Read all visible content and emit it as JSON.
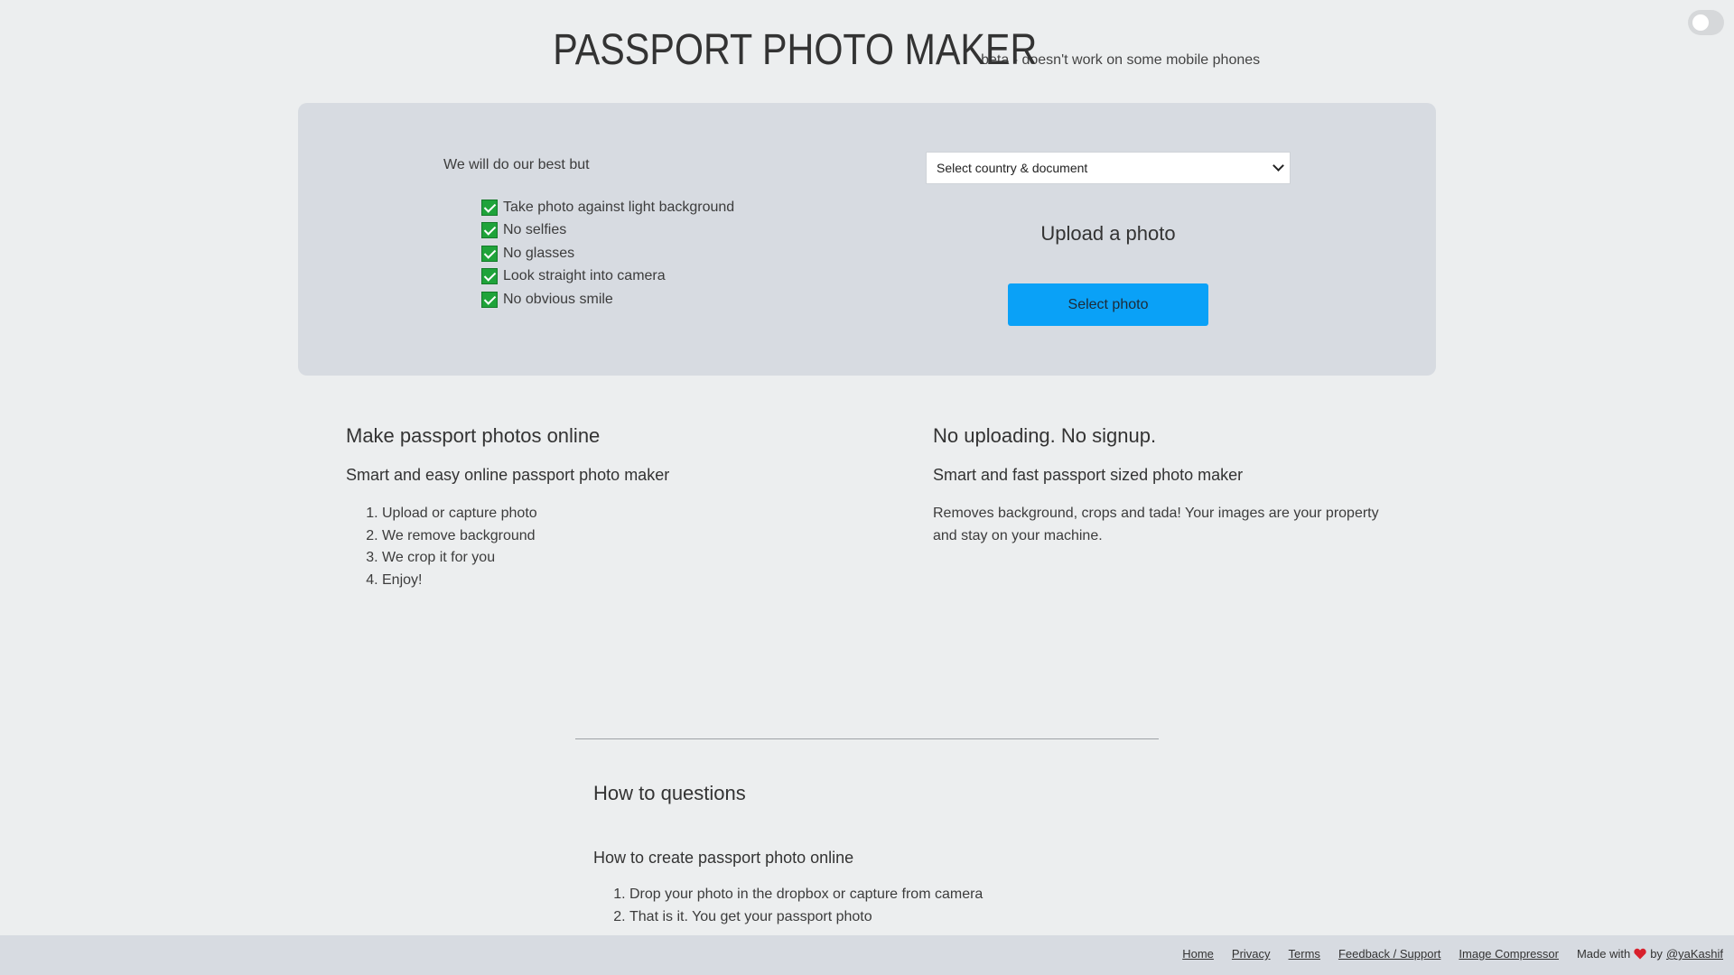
{
  "header": {
    "title": "PASSPORT PHOTO MAKER",
    "subtitle": "beta - doesn't work on some mobile phones"
  },
  "theme_toggle": {
    "icon": "toggle-switch-icon",
    "state": "off"
  },
  "hero": {
    "intro": "We will do our best but",
    "checklist": [
      "Take photo against light background",
      "No selfies",
      "No glasses",
      "Look straight into camera",
      "No obvious smile"
    ],
    "country_select": {
      "selected": "Select country & document"
    },
    "upload_heading": "Upload a photo",
    "select_button": "Select photo",
    "accent_color": "#0aa1f7",
    "check_color": "#1fa33a"
  },
  "left_col": {
    "heading": "Make passport photos online",
    "subheading": "Smart and easy online passport photo maker",
    "steps": [
      "Upload or capture photo",
      "We remove background",
      "We crop it for you",
      "Enjoy!"
    ]
  },
  "right_col": {
    "heading": "No uploading. No signup.",
    "subheading": "Smart and fast passport sized photo maker",
    "text": "Removes background, crops and tada! Your images are your property and stay on your machine."
  },
  "howto": {
    "heading": "How to questions",
    "subheading": "How to create passport photo online",
    "steps": [
      "Drop your photo in the dropbox or capture from camera",
      "That is it. You get your passport photo"
    ]
  },
  "footer": {
    "links": [
      "Home",
      "Privacy",
      "Terms",
      "Feedback / Support",
      "Image Compressor"
    ],
    "made_with": "Made with",
    "by": "by",
    "author": "@yaKashif",
    "heart_icon": "heart-icon",
    "heart_color": "#d8202c"
  }
}
